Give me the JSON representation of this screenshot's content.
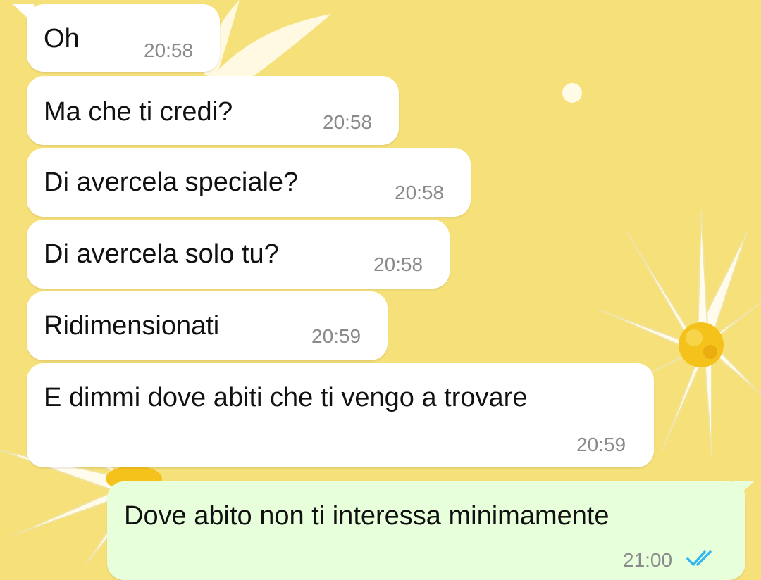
{
  "theme": {
    "wallpaper": "#f6e07a",
    "incoming_bubble": "#ffffff",
    "outgoing_bubble": "#e7ffdb",
    "read_ticks": "#34b7f1"
  },
  "messages": [
    {
      "text": "Oh",
      "time": "20:58",
      "direction": "incoming"
    },
    {
      "text": "Ma che ti credi?",
      "time": "20:58",
      "direction": "incoming"
    },
    {
      "text": "Di avercela speciale?",
      "time": "20:58",
      "direction": "incoming"
    },
    {
      "text": "Di avercela solo tu?",
      "time": "20:58",
      "direction": "incoming"
    },
    {
      "text": "Ridimensionati",
      "time": "20:59",
      "direction": "incoming"
    },
    {
      "text": "E dimmi dove abiti che ti vengo a trovare",
      "time": "20:59",
      "direction": "incoming"
    },
    {
      "text": "Dove abito non ti interessa minimamente",
      "time": "21:00",
      "direction": "outgoing",
      "status_icon": "double-check-icon"
    }
  ]
}
